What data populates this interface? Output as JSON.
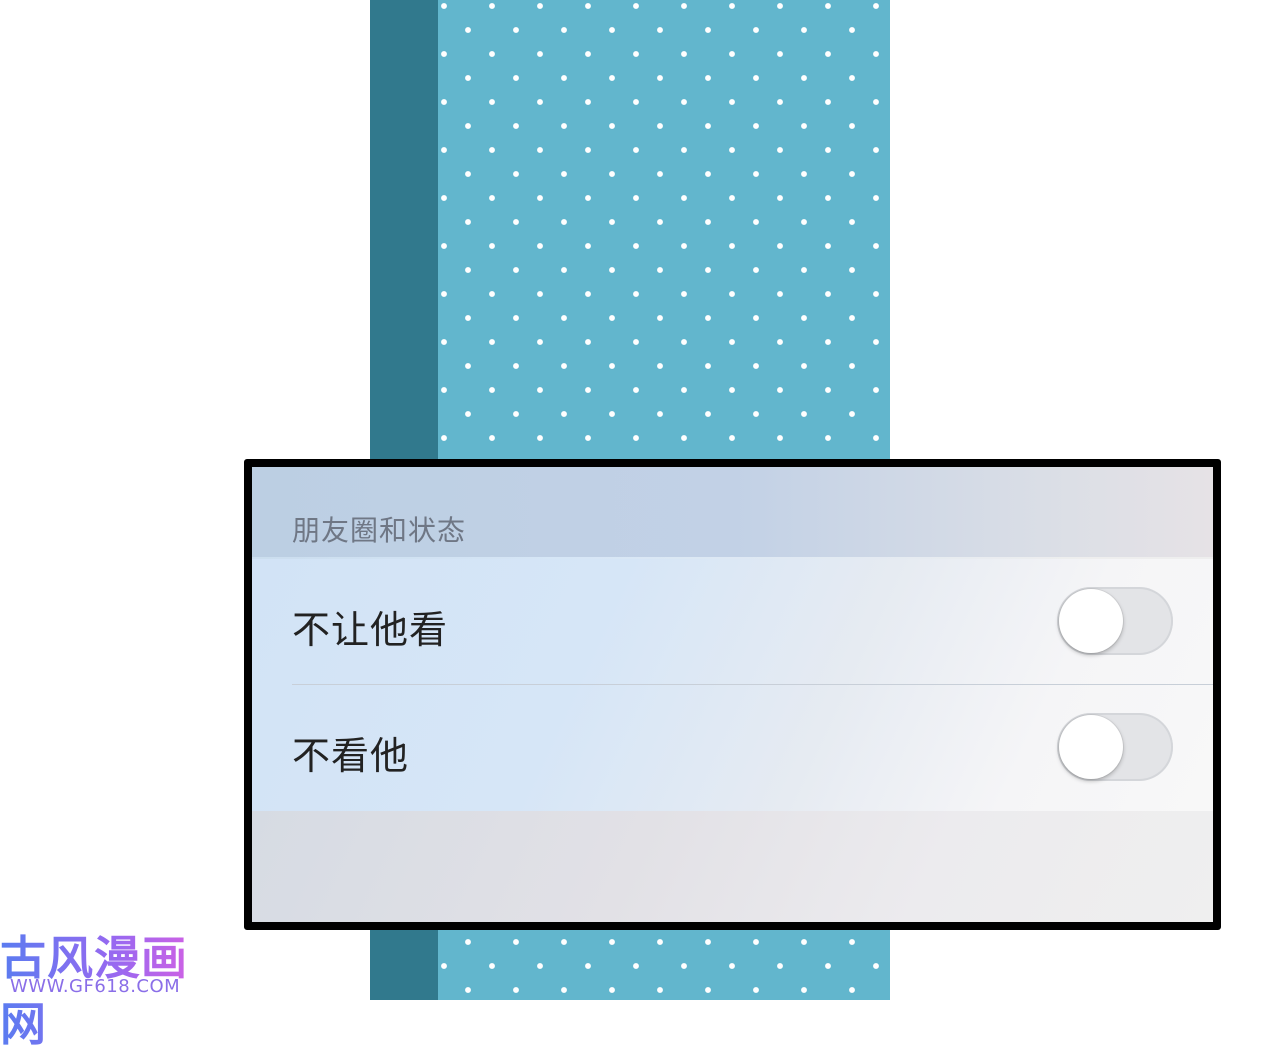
{
  "settings": {
    "section_title": "朋友圈和状态",
    "rows": [
      {
        "label": "不让他看",
        "toggle_on": false
      },
      {
        "label": "不看他",
        "toggle_on": false
      }
    ]
  },
  "watermark": {
    "title": "古风漫画网",
    "url": "WWW.GF618.COM"
  },
  "colors": {
    "strip_dark": "#31798d",
    "strip_dots_bg": "#62b6cd",
    "panel_border": "#000000",
    "toggle_off": "#e3e4e7"
  }
}
